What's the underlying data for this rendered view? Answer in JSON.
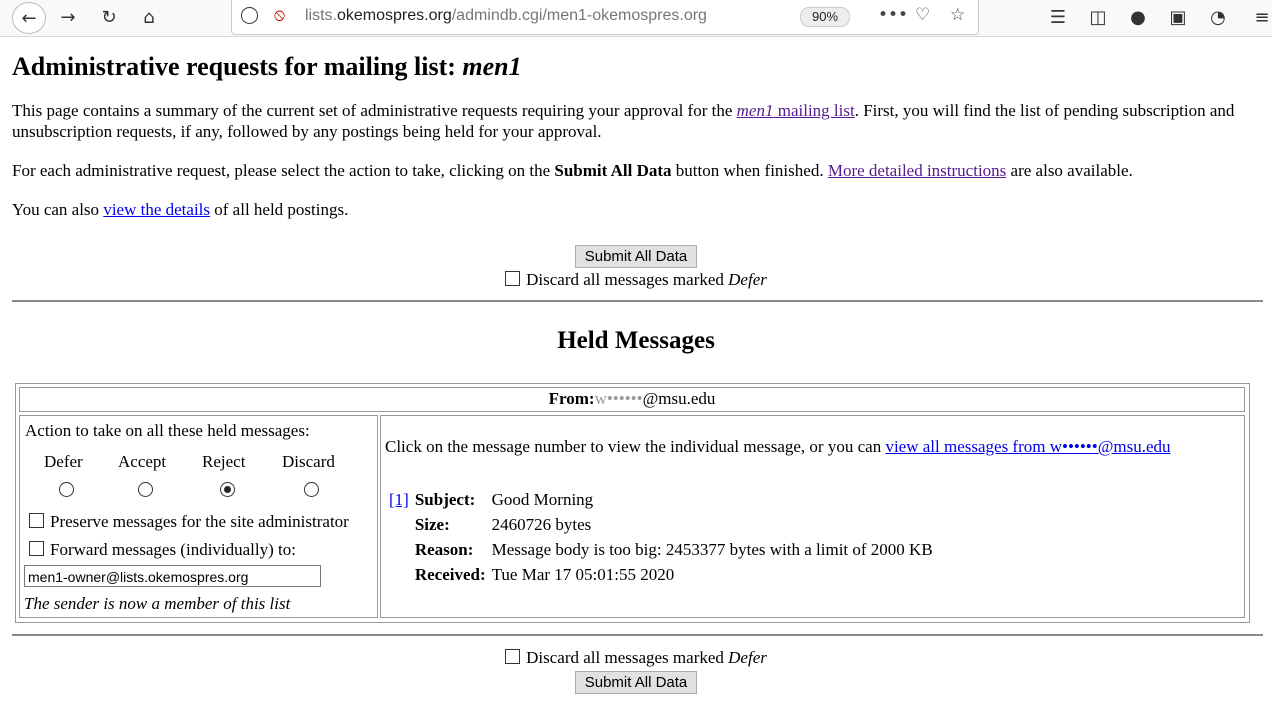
{
  "browser": {
    "url_prefix": "lists.",
    "url_domain": "okemospres.org",
    "url_path": "/admindb.cgi/men1-okemospres.org",
    "zoom": "90%"
  },
  "page": {
    "title_prefix": "Administrative requests for mailing list: ",
    "title_list": "men1",
    "intro_1a": "This page contains a summary of the current set of administrative requests requiring your approval for the ",
    "intro_1_link_em": "men1",
    "intro_1_link_rest": " mailing list",
    "intro_1b": ". First, you will find the list of pending subscription and unsubscription requests, if any, followed by any postings being held for your approval.",
    "intro_2a": "For each administrative request, please select the action to take, clicking on the ",
    "intro_2_bold": "Submit All Data",
    "intro_2b": " button when finished. ",
    "intro_2_link": "More detailed instructions",
    "intro_2c": " are also available.",
    "intro_3a": "You can also ",
    "intro_3_link": "view the details",
    "intro_3b": " of all held postings.",
    "submit_label": "Submit All Data",
    "discard_label": "Discard all messages marked ",
    "discard_em": "Defer",
    "held_heading": "Held Messages"
  },
  "held": {
    "from_label": "From:",
    "from_user": "w••••••",
    "from_domain": "@msu.edu",
    "action_heading": "Action to take on all these held messages:",
    "actions": [
      "Defer",
      "Accept",
      "Reject",
      "Discard"
    ],
    "selected_action": "Reject",
    "preserve_label": "Preserve messages for the site administrator",
    "forward_label": "Forward messages (individually) to:",
    "forward_value": "men1-owner@lists.okemospres.org",
    "member_note": "The sender is now a member of this list",
    "click_text": "Click on the message number to view the individual message, or you can ",
    "view_all_link": "view all messages from w••••••@msu.edu",
    "msg_number": "[1]",
    "subject_label": "Subject:",
    "subject_value": "Good Morning",
    "size_label": "Size:",
    "size_value": "2460726 bytes",
    "reason_label": "Reason:",
    "reason_value": "Message body is too big: 2453377 bytes with a limit of 2000 KB",
    "received_label": "Received:",
    "received_value": "Tue Mar 17 05:01:55 2020"
  }
}
